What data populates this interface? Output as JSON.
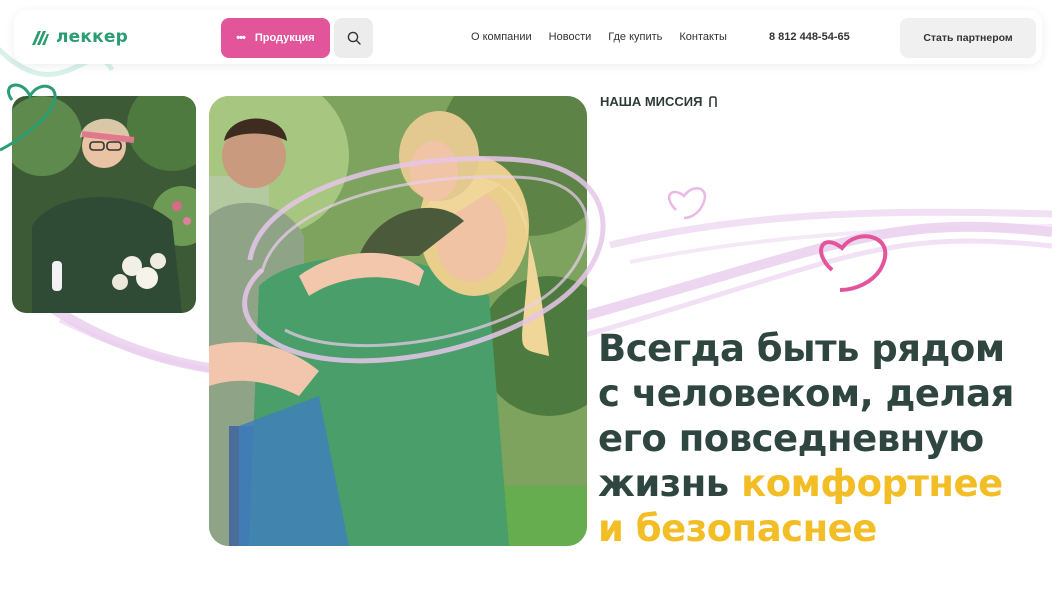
{
  "header": {
    "logo_text": "леккер",
    "products_label": "Продукция",
    "nav": [
      "О компании",
      "Новости",
      "Где купить",
      "Контакты"
    ],
    "phone": "8 812 448-54-65",
    "partner_label": "Стать партнером"
  },
  "hero": {
    "mission_label": "НАША МИССИЯ",
    "headline": {
      "line1": "Всегда быть рядом",
      "line2": "с человеком, делая",
      "line3": "его повседневную",
      "line4_plain": "жизнь ",
      "line4_accent": "комфортнее",
      "line5_accent": "и безопаснее"
    }
  },
  "colors": {
    "brand_green": "#2a9d72",
    "accent_pink": "#e2559b",
    "highlight_yellow": "#f3bd25",
    "headline": "#2f4640",
    "brush_lilac": "#e6c6ea"
  },
  "icons": {
    "search": "search-icon",
    "menu_dots": "dots-icon",
    "mission_arrow": "arrow-icon",
    "heart": "heart-icon"
  }
}
